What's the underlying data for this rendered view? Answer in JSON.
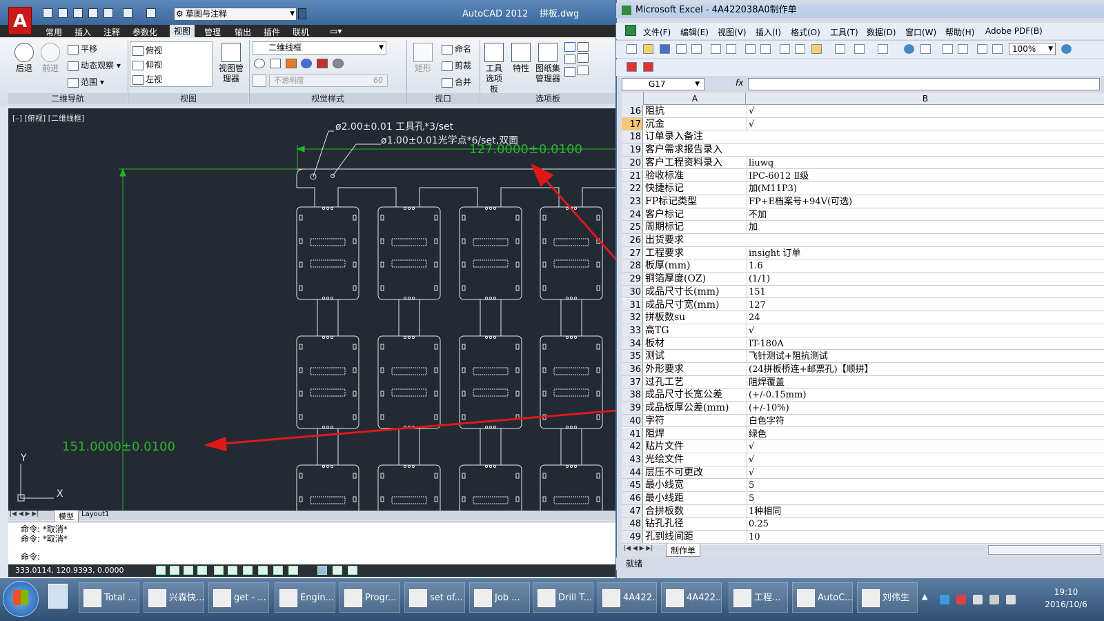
{
  "autocad": {
    "title_app": "AutoCAD 2012",
    "title_file": "拼板.dwg",
    "workspace": "草图与注释",
    "logo": "A",
    "tabs": [
      "常用",
      "插入",
      "注释",
      "参数化",
      "视图",
      "管理",
      "输出",
      "插件",
      "联机"
    ],
    "active_tab": "视图",
    "ribbon": {
      "nav": {
        "back": "后退",
        "forward": "前进",
        "pan": "平移",
        "orbit": "动态观察",
        "extents": "范围",
        "group": "二维导航"
      },
      "views": {
        "top": "俯视",
        "bottom": "仰视",
        "left": "左视",
        "manager": "视图管理器",
        "group": "视图"
      },
      "visual": {
        "style": "二维线框",
        "opacity": "不透明度",
        "opacity_val": "60",
        "group": "视觉样式"
      },
      "viewport": {
        "rect": "矩形",
        "name": "命名",
        "clip": "剪裁",
        "join": "合并",
        "group": "视口"
      },
      "palettes": {
        "tools": "工具选项板",
        "props": "特性",
        "sheetset": "图纸集管理器",
        "group": "选项板"
      }
    },
    "view_label": "[–] [俯视] [二维线框]",
    "annotations": {
      "tool_hole": "ø2.00±0.01 工具孔*3/set",
      "fiducial": "ø1.00±0.01光学点*6/set,双面",
      "width_dim": "127.0000±0.0100",
      "length_dim": "151.0000±0.0100"
    },
    "axis_y": "Y",
    "axis_x": "X",
    "layout_tabs": {
      "model": "模型",
      "layout1": "Layout1"
    },
    "commands": [
      "命令: *取消*",
      "命令: *取消*",
      "命令:"
    ],
    "coords": "333.0114,  120.9393,  0.0000"
  },
  "excel": {
    "title": "Microsoft Excel - 4A422038A0制作单",
    "menu": [
      "文件(F)",
      "编辑(E)",
      "视图(V)",
      "插入(I)",
      "格式(O)",
      "工具(T)",
      "数据(D)",
      "窗口(W)",
      "帮助(H)",
      "Adobe PDF(B)"
    ],
    "zoom": "100%",
    "namebox": "G17",
    "fx": "fx",
    "columns": [
      "A",
      "B"
    ],
    "rows": [
      {
        "n": "16",
        "a": "阻抗",
        "b": "√"
      },
      {
        "n": "17",
        "a": "沉金",
        "b": "√"
      },
      {
        "n": "18",
        "a": "订单录入备注",
        "b": ""
      },
      {
        "n": "19",
        "a": "客户需求报告录入",
        "b": ""
      },
      {
        "n": "20",
        "a": "客户工程资料录入",
        "b": "liuwq"
      },
      {
        "n": "21",
        "a": "验收标准",
        "b": "IPC-6012 Ⅱ级"
      },
      {
        "n": "22",
        "a": "快捷标记",
        "b": "加(M11P3)"
      },
      {
        "n": "23",
        "a": "FP标记类型",
        "b": "FP+E档案号+94V(可选)"
      },
      {
        "n": "24",
        "a": "客户标记",
        "b": "不加"
      },
      {
        "n": "25",
        "a": "周期标记",
        "b": "加"
      },
      {
        "n": "26",
        "a": "出货要求",
        "b": ""
      },
      {
        "n": "27",
        "a": "工程要求",
        "b": "insight 订单"
      },
      {
        "n": "28",
        "a": "板厚(mm)",
        "b": "1.6"
      },
      {
        "n": "29",
        "a": "铜箔厚度(OZ)",
        "b": "(1/1)"
      },
      {
        "n": "30",
        "a": "成品尺寸长(mm)",
        "b": "151"
      },
      {
        "n": "31",
        "a": "成品尺寸宽(mm)",
        "b": "127"
      },
      {
        "n": "32",
        "a": "拼板数su",
        "b": "24"
      },
      {
        "n": "33",
        "a": "高TG",
        "b": "√"
      },
      {
        "n": "34",
        "a": "板材",
        "b": "IT-180A"
      },
      {
        "n": "35",
        "a": "测试",
        "b": "飞针测试+阻抗测试"
      },
      {
        "n": "36",
        "a": "外形要求",
        "b": "(24拼板桥连+邮票孔)【顺拼】"
      },
      {
        "n": "37",
        "a": "过孔工艺",
        "b": "阻焊覆盖"
      },
      {
        "n": "38",
        "a": "成品尺寸长宽公差",
        "b": "(+/-0.15mm)"
      },
      {
        "n": "39",
        "a": "成品板厚公差(mm)",
        "b": "(+/-10%)"
      },
      {
        "n": "40",
        "a": "字符",
        "b": "白色字符"
      },
      {
        "n": "41",
        "a": "阻焊",
        "b": "绿色"
      },
      {
        "n": "42",
        "a": "贴片文件",
        "b": "√"
      },
      {
        "n": "43",
        "a": "光绘文件",
        "b": "√"
      },
      {
        "n": "44",
        "a": "层压不可更改",
        "b": "√"
      },
      {
        "n": "45",
        "a": "最小线宽",
        "b": "5"
      },
      {
        "n": "46",
        "a": "最小线距",
        "b": "5"
      },
      {
        "n": "47",
        "a": "合拼板数",
        "b": "1种相同"
      },
      {
        "n": "48",
        "a": "钻孔孔径",
        "b": "0.25"
      },
      {
        "n": "49",
        "a": "孔到线间距",
        "b": "10"
      }
    ],
    "selected_row": "17",
    "sheet_tab": "制作单",
    "status": "就绪"
  },
  "taskbar": {
    "items": [
      "Total ...",
      "兴森快...",
      "get - ...",
      "Engin...",
      "Progr...",
      "set of...",
      "Job ...",
      "Drill T...",
      "4A422...",
      "4A422...",
      "工程...",
      "AutoC...",
      "刘伟生"
    ],
    "time": "19:10",
    "date": "2016/10/6"
  },
  "colors": {
    "canvas": "#232a34",
    "dim_green": "#28b428",
    "arrow_red": "#e01818",
    "outline": "#e8e8e8"
  }
}
